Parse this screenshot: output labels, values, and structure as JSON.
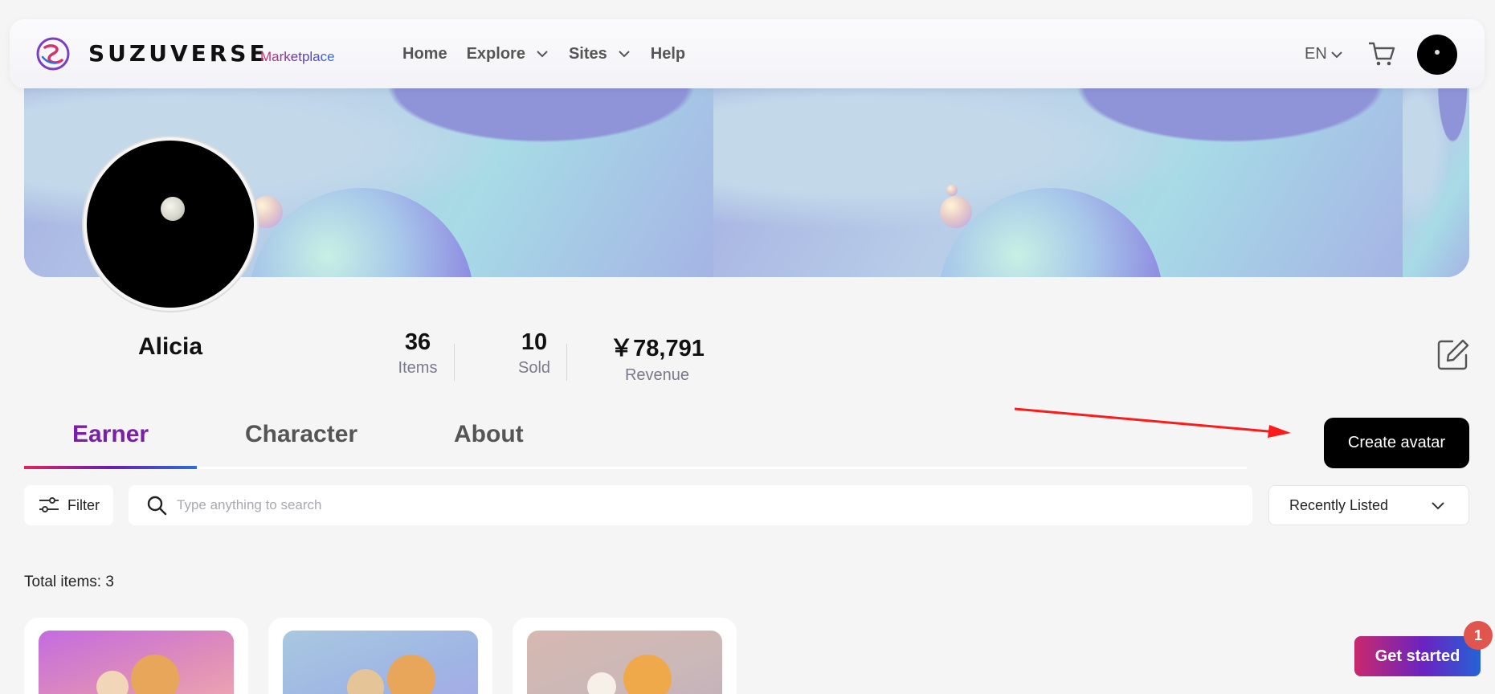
{
  "header": {
    "brand": "SUZUVERSE",
    "brand_sub": "Marketplace",
    "nav": [
      {
        "label": "Home"
      },
      {
        "label": "Explore"
      },
      {
        "label": "Sites"
      },
      {
        "label": "Help"
      }
    ],
    "language": "EN"
  },
  "profile": {
    "name": "Alicia",
    "stats": [
      {
        "value": "36",
        "label": "Items"
      },
      {
        "value": "10",
        "label": "Sold"
      },
      {
        "value": "￥78,791",
        "label": "Revenue"
      }
    ]
  },
  "tabs": [
    {
      "label": "Earner",
      "active": true
    },
    {
      "label": "Character",
      "active": false
    },
    {
      "label": "About",
      "active": false
    }
  ],
  "actions": {
    "create_avatar": "Create avatar"
  },
  "toolbar": {
    "filter_label": "Filter",
    "search_placeholder": "Type anything to search",
    "sort_value": "Recently Listed"
  },
  "items": {
    "total_label": "Total items: 3"
  },
  "floating": {
    "get_started": "Get started",
    "badge_count": "1"
  },
  "colors": {
    "accent_purple": "#7a1fa8",
    "annotation_red": "#ff1a1a"
  }
}
